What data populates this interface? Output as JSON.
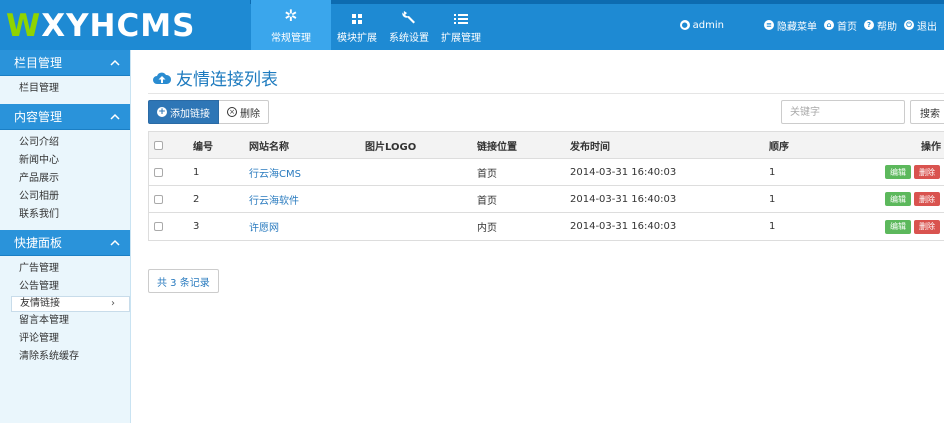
{
  "header": {
    "logo_mark": "W",
    "logo_text": "XYHCMS",
    "nav": [
      {
        "label": "常规管理",
        "icon": "gear-icon",
        "active": true
      },
      {
        "label": "模块扩展",
        "icon": "grid-icon",
        "active": false
      },
      {
        "label": "系统设置",
        "icon": "wrench-icon",
        "active": false
      },
      {
        "label": "扩展管理",
        "icon": "list-icon",
        "active": false
      }
    ],
    "user": "admin",
    "links": {
      "hide_menu": "隐藏菜单",
      "home": "首页",
      "help": "帮助",
      "logout": "退出"
    }
  },
  "sidebar": {
    "sections": [
      {
        "title": "栏目管理",
        "items": [
          "栏目管理"
        ]
      },
      {
        "title": "内容管理",
        "items": [
          "公司介绍",
          "新闻中心",
          "产品展示",
          "公司相册",
          "联系我们"
        ]
      },
      {
        "title": "快捷面板",
        "items": [
          "广告管理",
          "公告管理",
          "友情链接",
          "留言本管理",
          "评论管理",
          "清除系统缓存"
        ]
      }
    ],
    "active_item": "友情链接",
    "active_arrow": "›"
  },
  "main": {
    "title": "友情连接列表",
    "toolbar": {
      "add_label": "添加链接",
      "delete_label": "删除"
    },
    "search": {
      "placeholder": "关键字",
      "value": "",
      "button_label": "搜索"
    },
    "table": {
      "headers": [
        "编号",
        "网站名称",
        "图片LOGO",
        "链接位置",
        "发布时间",
        "顺序",
        "操作"
      ],
      "rows": [
        {
          "id": "1",
          "name": "行云海CMS",
          "logo": "",
          "position": "首页",
          "time": "2014-03-31 16:40:03",
          "order": "1"
        },
        {
          "id": "2",
          "name": "行云海软件",
          "logo": "",
          "position": "首页",
          "time": "2014-03-31 16:40:03",
          "order": "1"
        },
        {
          "id": "3",
          "name": "许愿网",
          "logo": "",
          "position": "内页",
          "time": "2014-03-31 16:40:03",
          "order": "1"
        }
      ],
      "edit_label": "编辑",
      "delete_label": "删除"
    },
    "pager": "共 3 条记录"
  },
  "colors": {
    "header": "#1e8ad3",
    "nav_active": "#3aa6ec",
    "sidebar_bg": "#eaf6fc",
    "sidebar_head": "#2a93da",
    "primary_button": "#2e76b6",
    "edit_button": "#5cb85c",
    "delete_button": "#d9534f",
    "link": "#2a7bbf"
  }
}
